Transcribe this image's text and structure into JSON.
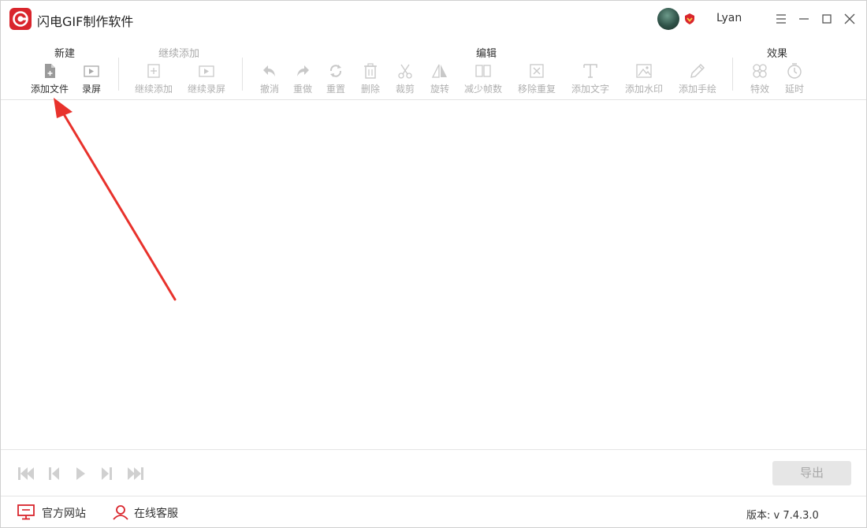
{
  "app": {
    "title": "闪电GIF制作软件",
    "username": "Lyan"
  },
  "toolbar": {
    "groups": {
      "new": "新建",
      "continue_add": "继续添加",
      "edit": "编辑",
      "effects": "效果"
    },
    "tools": {
      "add_file": "添加文件",
      "record": "录屏",
      "continue_add": "继续添加",
      "continue_record": "继续录屏",
      "undo": "撤消",
      "redo": "重做",
      "reset": "重置",
      "delete": "删除",
      "crop": "裁剪",
      "rotate": "旋转",
      "reduce_frames": "减少帧数",
      "remove_duplicates": "移除重复",
      "add_text": "添加文字",
      "add_watermark": "添加水印",
      "add_drawing": "添加手绘",
      "special_effects": "特效",
      "delay": "延时"
    }
  },
  "player": {
    "export_label": "导出"
  },
  "statusbar": {
    "website": "官方网站",
    "support": "在线客服",
    "version": "版本: v 7.4.3.0"
  },
  "colors": {
    "brand": "#d9252c",
    "arrow": "#e8322c",
    "disabled": "#b0b0b0"
  }
}
